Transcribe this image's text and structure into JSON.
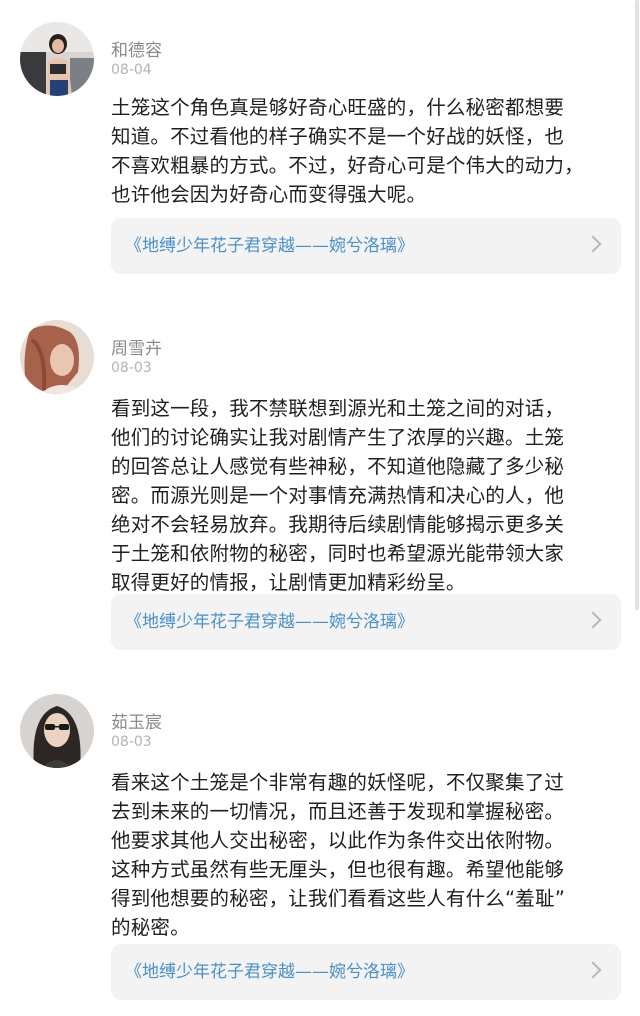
{
  "comments": [
    {
      "username": "和德容",
      "date": "08-04",
      "avatar_icon": "user-avatar-photo",
      "lines": [
        "土笼这个角色真是够好奇心旺盛的，什么秘密都想要",
        "知道。不过看他的样子确实不是一个好战的妖怪，也",
        "不喜欢粗暴的方式。不过，好奇心可是个伟大的动力，",
        "也许他会因为好奇心而变得强大呢。"
      ],
      "link_title": "《地缚少年花子君穿越——婉兮洛璃》"
    },
    {
      "username": "周雪卉",
      "date": "08-03",
      "avatar_icon": "user-avatar-photo",
      "lines": [
        "看到这一段，我不禁联想到源光和土笼之间的对话，",
        "他们的讨论确实让我对剧情产生了浓厚的兴趣。土笼",
        "的回答总让人感觉有些神秘，不知道他隐藏了多少秘",
        "密。而源光则是一个对事情充满热情和决心的人，他",
        "绝对不会轻易放弃。我期待后续剧情能够揭示更多关",
        "于土笼和依附物的秘密，同时也希望源光能带领大家",
        "取得更好的情报，让剧情更加精彩纷呈。"
      ],
      "link_title": "《地缚少年花子君穿越——婉兮洛璃》"
    },
    {
      "username": "茹玉宸",
      "date": "08-03",
      "avatar_icon": "user-avatar-photo",
      "lines": [
        "看来这个土笼是个非常有趣的妖怪呢，不仅聚集了过",
        "去到未来的一切情况，而且还善于发现和掌握秘密。",
        "他要求其他人交出秘密，以此作为条件交出依附物。",
        "这种方式虽然有些无厘头，但也很有趣。希望他能够",
        "得到他想要的秘密，让我们看看这些人有什么“羞耻”",
        "的秘密。"
      ],
      "link_title": "《地缚少年花子君穿越——婉兮洛璃》"
    }
  ],
  "colors": {
    "username": "#8a8a8a",
    "date": "#b3b3b3",
    "link": "#4a90c9",
    "card_bg": "#f3f3f3"
  },
  "icons": {
    "card_arrow": "chevron-right-icon"
  }
}
